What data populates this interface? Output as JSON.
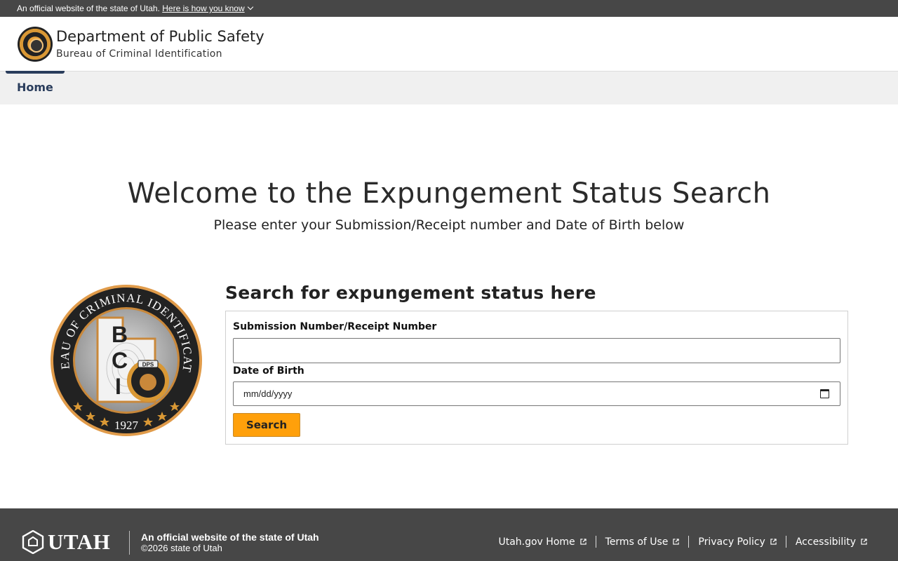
{
  "banner": {
    "text": "An official website of the state of Utah.",
    "link": "Here is how you know"
  },
  "header": {
    "department": "Department of Public Safety",
    "bureau": "Bureau of Criminal Identification"
  },
  "nav": {
    "items": [
      {
        "label": "Home",
        "active": true
      }
    ]
  },
  "main": {
    "welcome": "Welcome to the Expungement Status Search",
    "subtitle": "Please enter your Submission/Receipt number and Date of Birth below",
    "search_title": "Search for expungement status here",
    "seal_text": {
      "ring": "BUREAU OF CRIMINAL IDENTIFICATION",
      "year": "1927",
      "letters": [
        "B",
        "C",
        "I"
      ],
      "badge": "DPS"
    },
    "form": {
      "submission_label": "Submission Number/Receipt Number",
      "submission_value": "",
      "dob_label": "Date of Birth",
      "dob_placeholder": "mm/dd/yyyy",
      "search_label": "Search"
    }
  },
  "footer": {
    "logo_text": "UTAH",
    "official": "An official website of the state of Utah",
    "copyright": "©2026 state of Utah",
    "links": [
      "Utah.gov Home",
      "Terms of Use",
      "Privacy Policy",
      "Accessibility"
    ]
  },
  "colors": {
    "banner_bg": "#474747",
    "nav_accent": "#2a3d5c",
    "button": "#ffa00b",
    "footer_bg": "#474747"
  }
}
